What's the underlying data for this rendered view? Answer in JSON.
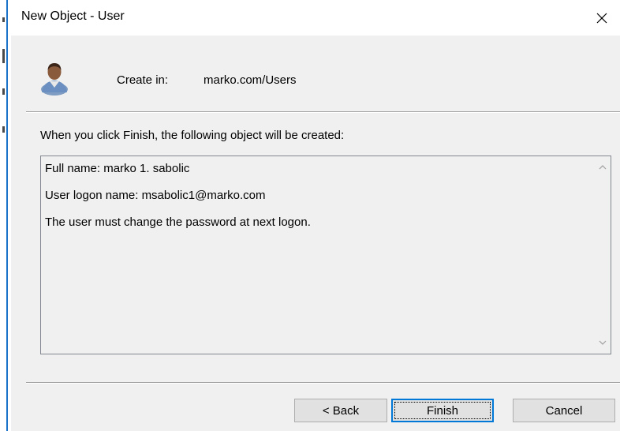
{
  "window": {
    "title": "New Object - User",
    "close_icon": "close-icon"
  },
  "header": {
    "icon": "user-icon",
    "create_in_label": "Create in:",
    "create_in_path": "marko.com/Users"
  },
  "body": {
    "intro": "When you click Finish, the following object will be created:",
    "summary_lines": [
      "Full name: marko 1. sabolic",
      "User logon name: msabolic1@marko.com",
      "The user must change the password at next logon."
    ]
  },
  "buttons": {
    "back": "< Back",
    "finish": "Finish",
    "cancel": "Cancel"
  },
  "colors": {
    "dialog_bg": "#f0f0f0",
    "titlebar_bg": "#ffffff",
    "focus_border": "#0078d7",
    "button_bg": "#e1e1e1"
  }
}
